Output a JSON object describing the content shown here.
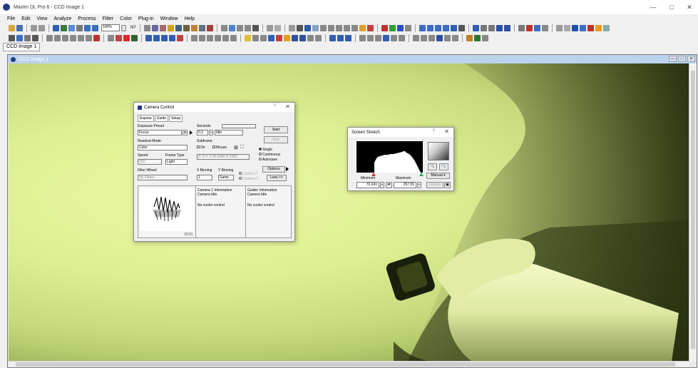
{
  "app": {
    "title": "MaxIm DL Pro 6 - CCD Image 1",
    "doc_title": "CCD Image 1",
    "tab_label": "CCD Image 1"
  },
  "window_controls": {
    "minimize": "—",
    "maximize": "□",
    "close": "✕"
  },
  "menu": [
    "File",
    "Edit",
    "View",
    "Analyze",
    "Process",
    "Filter",
    "Color",
    "Plug-in",
    "Window",
    "Help"
  ],
  "toolbar": {
    "zoom_value": "100%",
    "help_button": "N?"
  },
  "camera_control": {
    "title": "Camera Control",
    "tabs": [
      "Expose",
      "Guide",
      "Setup"
    ],
    "exposure_preset_label": "Exposure Preset",
    "exposure_preset_value": "Focus",
    "seconds_label": "Seconds",
    "seconds_value": "0.2",
    "status_value": "Idle",
    "start_button": "Start",
    "stop_button": "Stop",
    "readout_mode_label": "Readout Mode",
    "readout_mode_value": "Color",
    "subframe_label": "Subframe",
    "subframe_on": "On",
    "subframe_mouse": "Mouse",
    "subframe_coords": "X: 0 Y: 0 W:2040 H:1080",
    "mode_single": "Single",
    "mode_continuous": "Continuous",
    "mode_autosave": "Autosave",
    "speed_label": "Speed",
    "speed_value": "ISO",
    "frame_type_label": "Frame Type",
    "frame_type_value": "Light",
    "options_button": "Options",
    "filter_wheel_label": "Filter Wheel",
    "filter_wheel_value": "No Filters",
    "x_binning_label": "X Binning",
    "x_binning_value": "1",
    "y_binning_label": "Y Binning",
    "y_binning_value": "Same",
    "camera1_label": "Camera 1",
    "camera2_label": "Camera 2",
    "less_button": "Less <<",
    "camera1_info_title": "Camera 1 Information",
    "camera1_status": "Camera Idle",
    "camera1_cooler": "No cooler control",
    "guider_info_title": "Guider Information",
    "guider_status": "Camera Idle",
    "guider_cooler": "No cooler control",
    "preview_counter": "3D(0)"
  },
  "screen_stretch": {
    "title": "Screen Stretch",
    "minimum_label": "Minimum",
    "maximum_label": "Maximum",
    "minimum_value": "70.241",
    "maximum_value": "257.55",
    "manual_button": "Manual",
    "update_button": "Update"
  },
  "colors": {
    "accent": "#1f3c88",
    "image_tint": "#dff093",
    "dialog_bg": "#f0f0f0",
    "doc_titlebar": "#bcd3ee"
  }
}
